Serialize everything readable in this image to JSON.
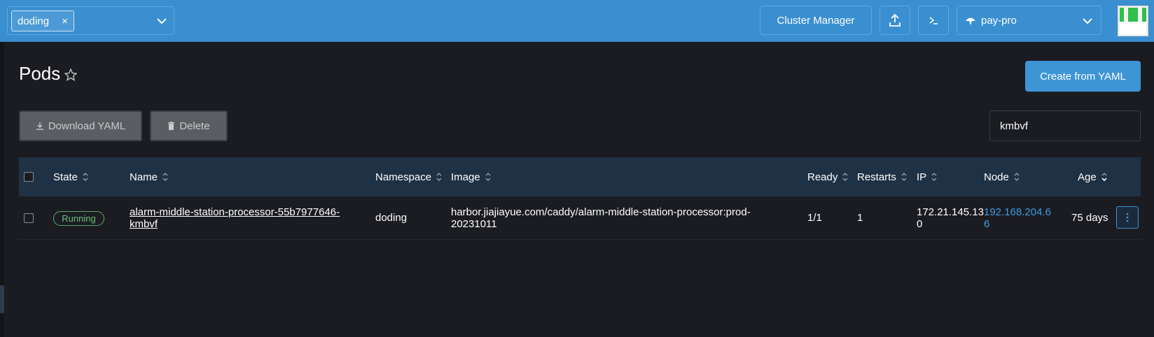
{
  "header": {
    "namespace_chip": "doding",
    "chip_close": "×",
    "cluster_manager_label": "Cluster Manager",
    "cluster_name": "pay-pro"
  },
  "page": {
    "title": "Pods",
    "create_label": "Create from YAML",
    "download_label": "Download YAML",
    "delete_label": "Delete",
    "search_value": "kmbvf"
  },
  "table": {
    "columns": [
      "State",
      "Name",
      "Namespace",
      "Image",
      "Ready",
      "Restarts",
      "IP",
      "Node",
      "Age"
    ],
    "rows": [
      {
        "state": "Running",
        "name_line1": "alarm-middle-station-processor-55b7977646-",
        "name_line2": "kmbvf",
        "namespace": "doding",
        "image_line1": "harbor.jiajiayue.com/caddy/alarm-middle-station-processor:prod-",
        "image_line2": "20231011",
        "ready": "1/1",
        "restarts": "1",
        "ip_line1": "172.21.145.13",
        "ip_line2": "0",
        "node_line1": "192.168.204.6",
        "node_line2": "6",
        "age": "75 days"
      }
    ]
  },
  "colors": {
    "header_bg": "#3a8fd0",
    "primary_button": "#3d95d6",
    "running_badge": "#6cc07a",
    "link": "#3d9be0"
  }
}
